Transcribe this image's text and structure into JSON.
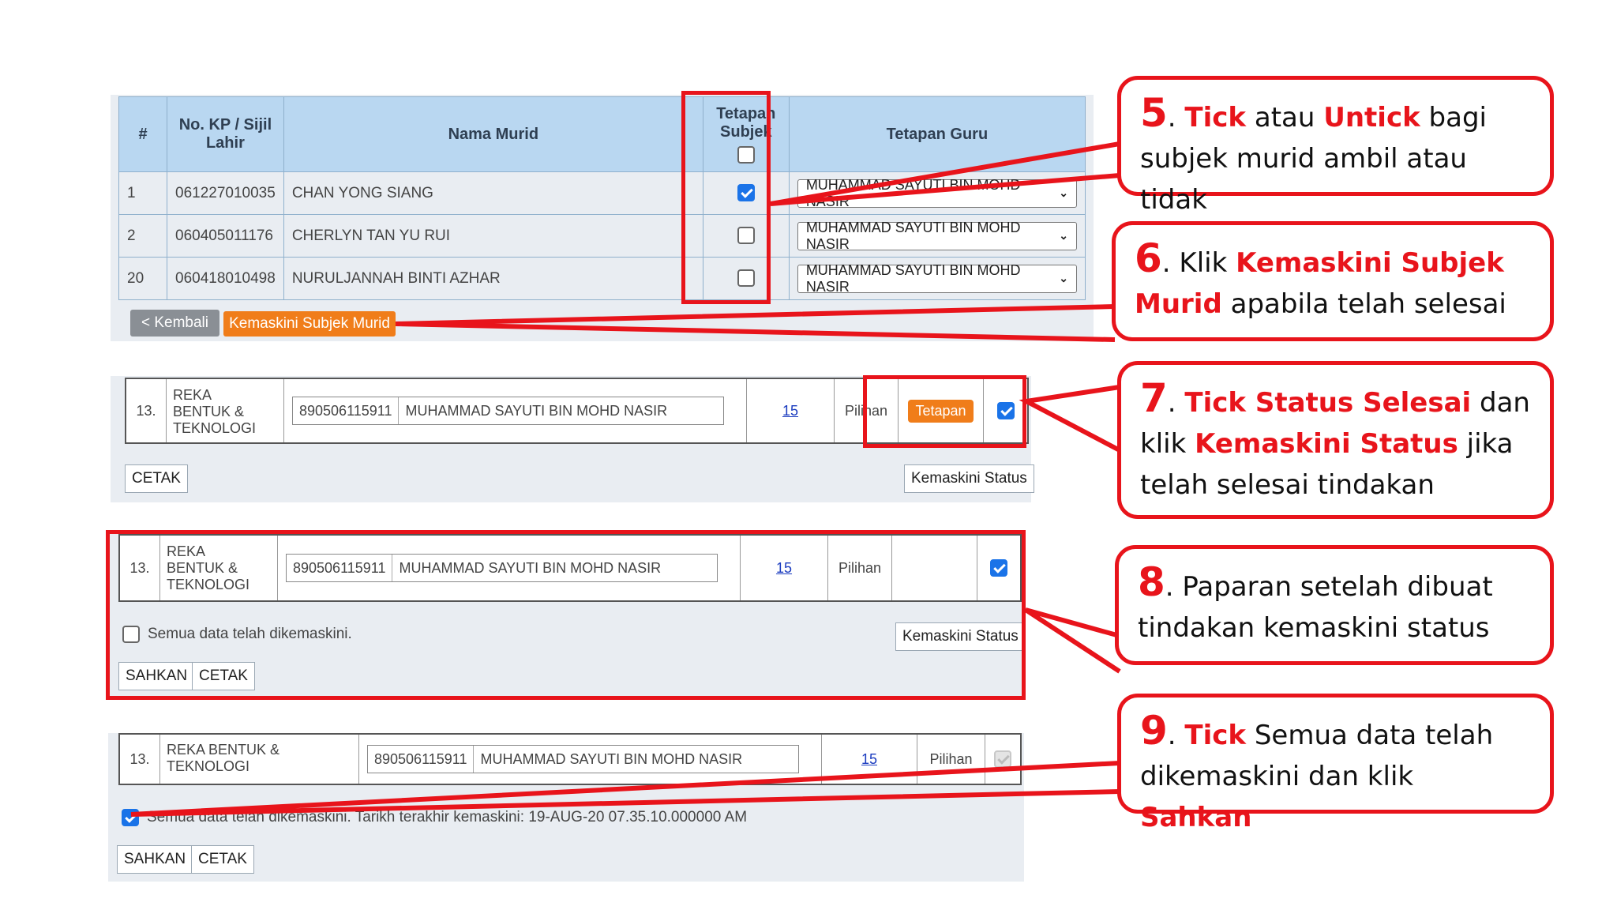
{
  "panel1": {
    "headers": {
      "num": "#",
      "kp": "No. KP / Sijil Lahir",
      "nama": "Nama Murid",
      "tetapan_subjek": "Tetapan Subjek",
      "tetapan_guru": "Tetapan Guru"
    },
    "rows": [
      {
        "num": "1",
        "kp": "061227010035",
        "nama": "CHAN YONG SIANG",
        "checked": true,
        "guru": "MUHAMMAD SAYUTI BIN MOHD NASIR"
      },
      {
        "num": "2",
        "kp": "060405011176",
        "nama": "CHERLYN TAN YU RUI",
        "checked": false,
        "guru": "MUHAMMAD SAYUTI BIN MOHD NASIR"
      },
      {
        "num": "20",
        "kp": "060418010498",
        "nama": "NURULJANNAH BINTI AZHAR",
        "checked": false,
        "guru": "MUHAMMAD SAYUTI BIN MOHD NASIR"
      }
    ],
    "btn_kembali": "< Kembali",
    "btn_kemaskini": "Kemaskini Subjek Murid"
  },
  "subject_row": {
    "num": "13.",
    "subject_stacked": "REKA\nBENTUK &\nTEKNOLOGI",
    "subject_wrap": "REKA BENTUK &\nTEKNOLOGI",
    "kp": "890506115911",
    "guru": "MUHAMMAD SAYUTI BIN MOHD NASIR",
    "count": "15",
    "jenis": "Pilihan"
  },
  "panel2": {
    "btn_tetapan": "Tetapan",
    "btn_cetak": "CETAK",
    "btn_kemaskini_status": "Kemaskini Status"
  },
  "panel3": {
    "semua_label": "Semua data telah dikemaskini.",
    "btn_kemaskini_status": "Kemaskini Status",
    "btn_sahkan": "SAHKAN",
    "btn_cetak": "CETAK"
  },
  "panel4": {
    "semua_label": "Semua data telah dikemaskini. Tarikh terakhir kemaskini: 19-AUG-20 07.35.10.000000 AM",
    "btn_sahkan": "SAHKAN",
    "btn_cetak": "CETAK"
  },
  "callouts": {
    "c5": {
      "num": "5",
      "p1": ". ",
      "h1": "Tick",
      "p2": " atau ",
      "h2": "Untick",
      "p3": " bagi subjek murid  ambil atau tidak"
    },
    "c6": {
      "num": "6",
      "p1": ". Klik ",
      "h1": "Kemaskini Subjek Murid",
      "p2": " apabila telah selesai"
    },
    "c7": {
      "num": "7",
      "p1": ". ",
      "h1": "Tick Status Selesai",
      "p2": " dan klik ",
      "h2": "Kemaskini Status",
      "p3": " jika telah selesai tindakan"
    },
    "c8": {
      "num": "8",
      "p1": ". Paparan setelah dibuat tindakan kemaskini status"
    },
    "c9": {
      "num": "9",
      "p1": ". ",
      "h1": "Tick",
      "p2": " Semua data telah dikemaskini dan klik ",
      "h2": "Sahkan"
    }
  },
  "colors": {
    "accent_red": "#e8141b",
    "header_blue": "#b9d7f1",
    "orange": "#f07d1a",
    "panel_bg": "#e9edf2"
  }
}
